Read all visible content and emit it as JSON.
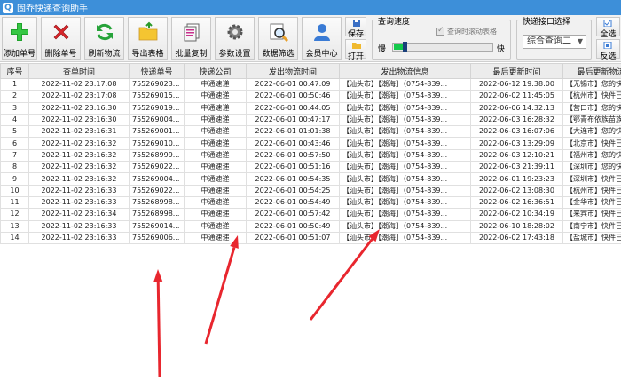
{
  "window": {
    "title": "固乔快递查询助手"
  },
  "toolbar": {
    "buttons": [
      {
        "id": "add",
        "label": "添加单号"
      },
      {
        "id": "delete",
        "label": "删除单号"
      },
      {
        "id": "refresh",
        "label": "刷新物流"
      },
      {
        "id": "export",
        "label": "导出表格"
      },
      {
        "id": "copy",
        "label": "批量复制"
      },
      {
        "id": "settings",
        "label": "参数设置"
      },
      {
        "id": "filter",
        "label": "数据筛选"
      },
      {
        "id": "member",
        "label": "会员中心"
      }
    ],
    "save_label": "保存",
    "open_label": "打开",
    "speed_group": {
      "label": "查询速度",
      "auto_scroll_label": "查询时滚动表格",
      "auto_scroll_checked": true,
      "slow_label": "慢",
      "fast_label": "快",
      "speed_fraction": 0.1
    },
    "api_group": {
      "label": "快递接口选择",
      "selected": "综合查询二"
    },
    "select_all_label": "全选",
    "invert_label": "反选"
  },
  "table": {
    "headers": [
      "序号",
      "查单时间",
      "快递单号",
      "快递公司",
      "发出物流时间",
      "发出物流信息",
      "最后更新时间",
      "最后更新物流"
    ],
    "rows": [
      [
        "1",
        "2022-11-02 23:17:08",
        "755269023...",
        "中通速递",
        "2022-06-01 00:47:09",
        "【汕头市】【潮海】（0754-839...",
        "2022-06-12 19:38:00",
        "【无锡市】您的快"
      ],
      [
        "2",
        "2022-11-02 23:17:08",
        "755269015...",
        "中通速递",
        "2022-06-01 00:50:46",
        "【汕头市】【潮海】（0754-839...",
        "2022-06-02 11:45:05",
        "【杭州市】快件已"
      ],
      [
        "3",
        "2022-11-02 23:16:30",
        "755269019...",
        "中通速递",
        "2022-06-01 00:44:05",
        "【汕头市】【潮海】（0754-839...",
        "2022-06-06 14:32:13",
        "【营口市】您的快"
      ],
      [
        "4",
        "2022-11-02 23:16:30",
        "755269004...",
        "中通速递",
        "2022-06-01 00:47:17",
        "【汕头市】【潮海】（0754-839...",
        "2022-06-03 16:28:32",
        "【鄂青布依族苗族"
      ],
      [
        "5",
        "2022-11-02 23:16:31",
        "755269001...",
        "中通速递",
        "2022-06-01 01:01:38",
        "【汕头市】【潮海】（0754-839...",
        "2022-06-03 16:07:06",
        "【大连市】您的快"
      ],
      [
        "6",
        "2022-11-02 23:16:32",
        "755269010...",
        "中通速递",
        "2022-06-01 00:43:46",
        "【汕头市】【潮海】（0754-839...",
        "2022-06-03 13:29:09",
        "【北京市】快件已"
      ],
      [
        "7",
        "2022-11-02 23:16:32",
        "755268999...",
        "中通速递",
        "2022-06-01 00:57:50",
        "【汕头市】【潮海】（0754-839...",
        "2022-06-03 12:10:21",
        "【福州市】您的快"
      ],
      [
        "8",
        "2022-11-02 23:16:32",
        "755269022...",
        "中通速递",
        "2022-06-01 00:51:16",
        "【汕头市】【潮海】（0754-839...",
        "2022-06-03 21:39:11",
        "【深圳市】您的快"
      ],
      [
        "9",
        "2022-11-02 23:16:32",
        "755269004...",
        "中通速递",
        "2022-06-01 00:54:35",
        "【汕头市】【潮海】（0754-839...",
        "2022-06-01 19:23:23",
        "【深圳市】快件已"
      ],
      [
        "10",
        "2022-11-02 23:16:33",
        "755269022...",
        "中通速递",
        "2022-06-01 00:54:25",
        "【汕头市】【潮海】（0754-839...",
        "2022-06-02 13:08:30",
        "【杭州市】快件已"
      ],
      [
        "11",
        "2022-11-02 23:16:33",
        "755268998...",
        "中通速递",
        "2022-06-01 00:54:49",
        "【汕头市】【潮海】（0754-839...",
        "2022-06-02 16:36:51",
        "【金华市】快件已"
      ],
      [
        "12",
        "2022-11-02 23:16:34",
        "755268998...",
        "中通速递",
        "2022-06-01 00:57:42",
        "【汕头市】【潮海】（0754-839...",
        "2022-06-02 10:34:19",
        "【来宾市】快件已"
      ],
      [
        "13",
        "2022-11-02 23:16:33",
        "755269014...",
        "中通速递",
        "2022-06-01 00:50:49",
        "【汕头市】【潮海】（0754-839...",
        "2022-06-10 18:28:02",
        "【南宁市】快件已"
      ],
      [
        "14",
        "2022-11-02 23:16:33",
        "755269006...",
        "中通速递",
        "2022-06-01 00:51:07",
        "【汕头市】【潮海】（0754-839...",
        "2022-06-02 17:43:18",
        "【盐城市】快件已"
      ]
    ]
  },
  "colors": {
    "titlebar": "#3d8fd9",
    "annotation_arrow": "#e8262e",
    "slider_fill": "#13c94a"
  }
}
